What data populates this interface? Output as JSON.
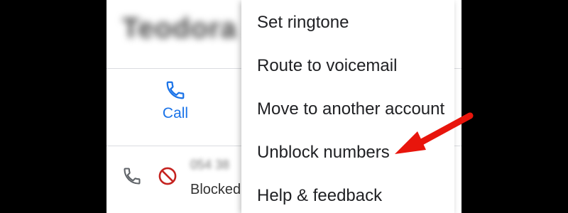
{
  "contact": {
    "name": "Teodora"
  },
  "actions": {
    "call_label": "Call"
  },
  "history": {
    "number": "054 38",
    "status": "Blocked"
  },
  "menu": {
    "items": [
      {
        "label": "Set ringtone"
      },
      {
        "label": "Route to voicemail"
      },
      {
        "label": "Move to another account"
      },
      {
        "label": "Unblock numbers"
      },
      {
        "label": "Help & feedback"
      }
    ]
  },
  "colors": {
    "accent": "#1a73e8",
    "block": "#c5221f",
    "annotation": "#e8150c"
  },
  "icons": [
    "phone-icon",
    "phone-icon",
    "block-icon",
    "arrow-annotation"
  ]
}
